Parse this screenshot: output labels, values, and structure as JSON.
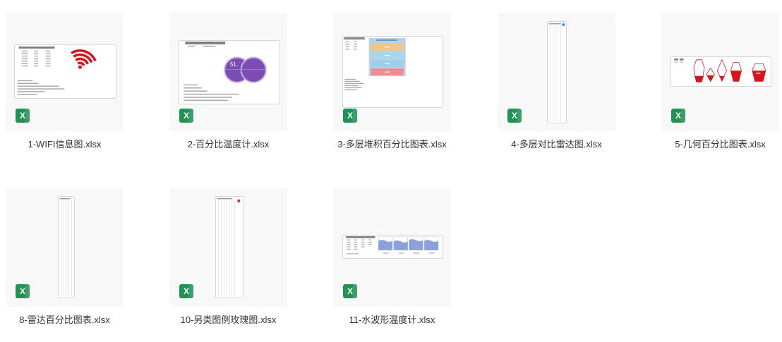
{
  "files": [
    {
      "name": "1-WIFI信息图.xlsx",
      "icon": "excel-icon",
      "icon_letter": "X"
    },
    {
      "name": "2-百分比温度计.xlsx",
      "icon": "excel-icon",
      "icon_letter": "X",
      "thumbnail_text": "51."
    },
    {
      "name": "3-多层堆积百分比图表.xlsx",
      "icon": "excel-icon",
      "icon_letter": "X"
    },
    {
      "name": "4-多层对比雷达图.xlsx",
      "icon": "excel-icon",
      "icon_letter": "X"
    },
    {
      "name": "5-几何百分比图表.xlsx",
      "icon": "excel-icon",
      "icon_letter": "X"
    },
    {
      "name": "8-雷达百分比图表.xlsx",
      "icon": "excel-icon",
      "icon_letter": "X"
    },
    {
      "name": "10-另类图例玫瑰图.xlsx",
      "icon": "excel-icon",
      "icon_letter": "X"
    },
    {
      "name": "11-水波形温度计.xlsx",
      "icon": "excel-icon",
      "icon_letter": "X"
    }
  ],
  "colors": {
    "tile_background": "#f8f8f8",
    "excel_green": "#1f9254",
    "label_text": "#333333",
    "preview_red": "#d9141c",
    "preview_purple": "#7b4db2",
    "preview_water_blue": "#8ca1dc"
  }
}
